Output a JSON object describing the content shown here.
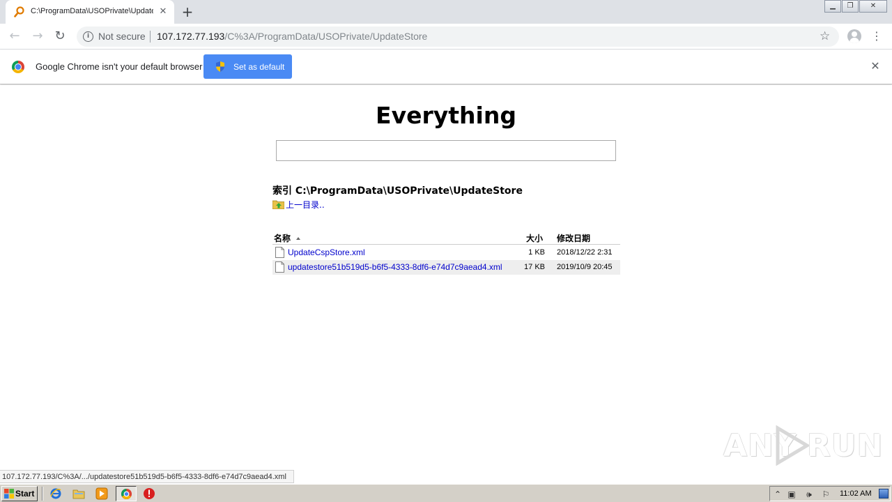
{
  "browser": {
    "tab": {
      "title": "C:\\ProgramData\\USOPrivate\\UpdateStore"
    },
    "new_tab_label": "+",
    "toolbar": {
      "security_label": "Not secure",
      "url_host": "107.172.77.193",
      "url_path": "/C%3A/ProgramData/USOPrivate/UpdateStore"
    },
    "infobar": {
      "message": "Google Chrome isn't your default browser",
      "button_label": "Set as default"
    },
    "status_url": "107.172.77.193/C%3A/.../updatestore51b519d5-b6f5-4333-8df6-e74d7c9aead4.xml"
  },
  "page": {
    "title": "Everything",
    "search_value": "",
    "index_heading": "索引 C:\\ProgramData\\USOPrivate\\UpdateStore",
    "up_link_label": "上一目录..",
    "columns": {
      "name": "名称",
      "size": "大小",
      "modified": "修改日期"
    },
    "files": [
      {
        "name": "UpdateCspStore.xml",
        "size": "1 KB",
        "modified": "2018/12/22 2:31"
      },
      {
        "name": "updatestore51b519d5-b6f5-4333-8df6-e74d7c9aead4.xml",
        "size": "17 KB",
        "modified": "2019/10/9 20:45"
      }
    ]
  },
  "watermark": {
    "left": "ANY",
    "right": "RUN"
  },
  "taskbar": {
    "start_label": "Start",
    "clock": "11:02 AM"
  },
  "colors": {
    "link": "#0000cc",
    "infobar_button": "#4a8af4",
    "tabstrip": "#dee1e6",
    "taskbar": "#d4d0c8"
  }
}
